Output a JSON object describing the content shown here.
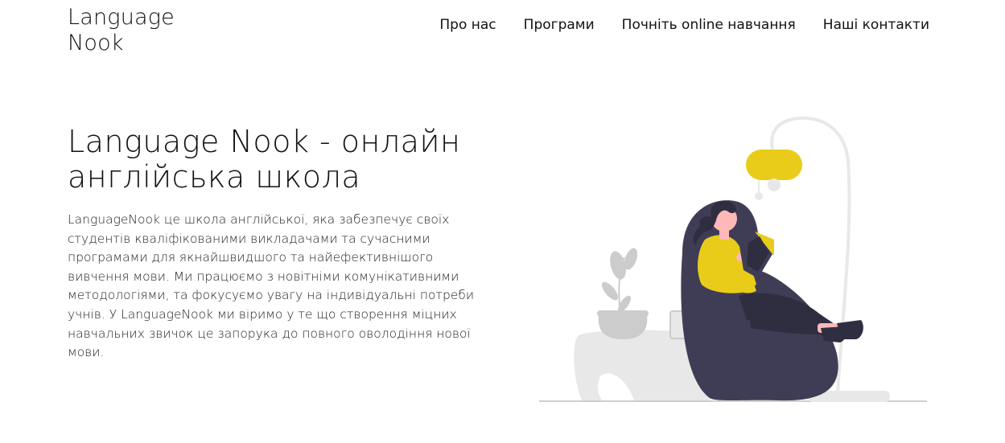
{
  "header": {
    "logo": "Language\nNook",
    "nav": [
      {
        "label": "Про нас"
      },
      {
        "label": "Програми"
      },
      {
        "label": "Почніть online навчання"
      },
      {
        "label": "Наші контакти"
      }
    ]
  },
  "hero": {
    "title": "Language Nook - онлайн англійська школа",
    "description": "LanguageNook це школа англійської, яка забезпечує своїх студентів кваліфікованими викладачами та сучасними програмами для якнайшвидшого та найефективнішого вивчення мови. Ми працюємо з новітніми комунікативними методологіями, та фокусуємо увагу на індивідуальні потреби учнів. У LanguageNook ми віримо у те що створення міцних навчальних звичок це запорука до повного оволодіння нової мови."
  },
  "illustration": {
    "name": "woman-reading-illustration",
    "colors": {
      "accent": "#e9cc1a",
      "dark": "#3f3d56",
      "light_gray": "#e8e8e8",
      "mid_gray": "#cccccc",
      "skin": "#ffb8b8",
      "hair": "#2f2e41"
    }
  }
}
